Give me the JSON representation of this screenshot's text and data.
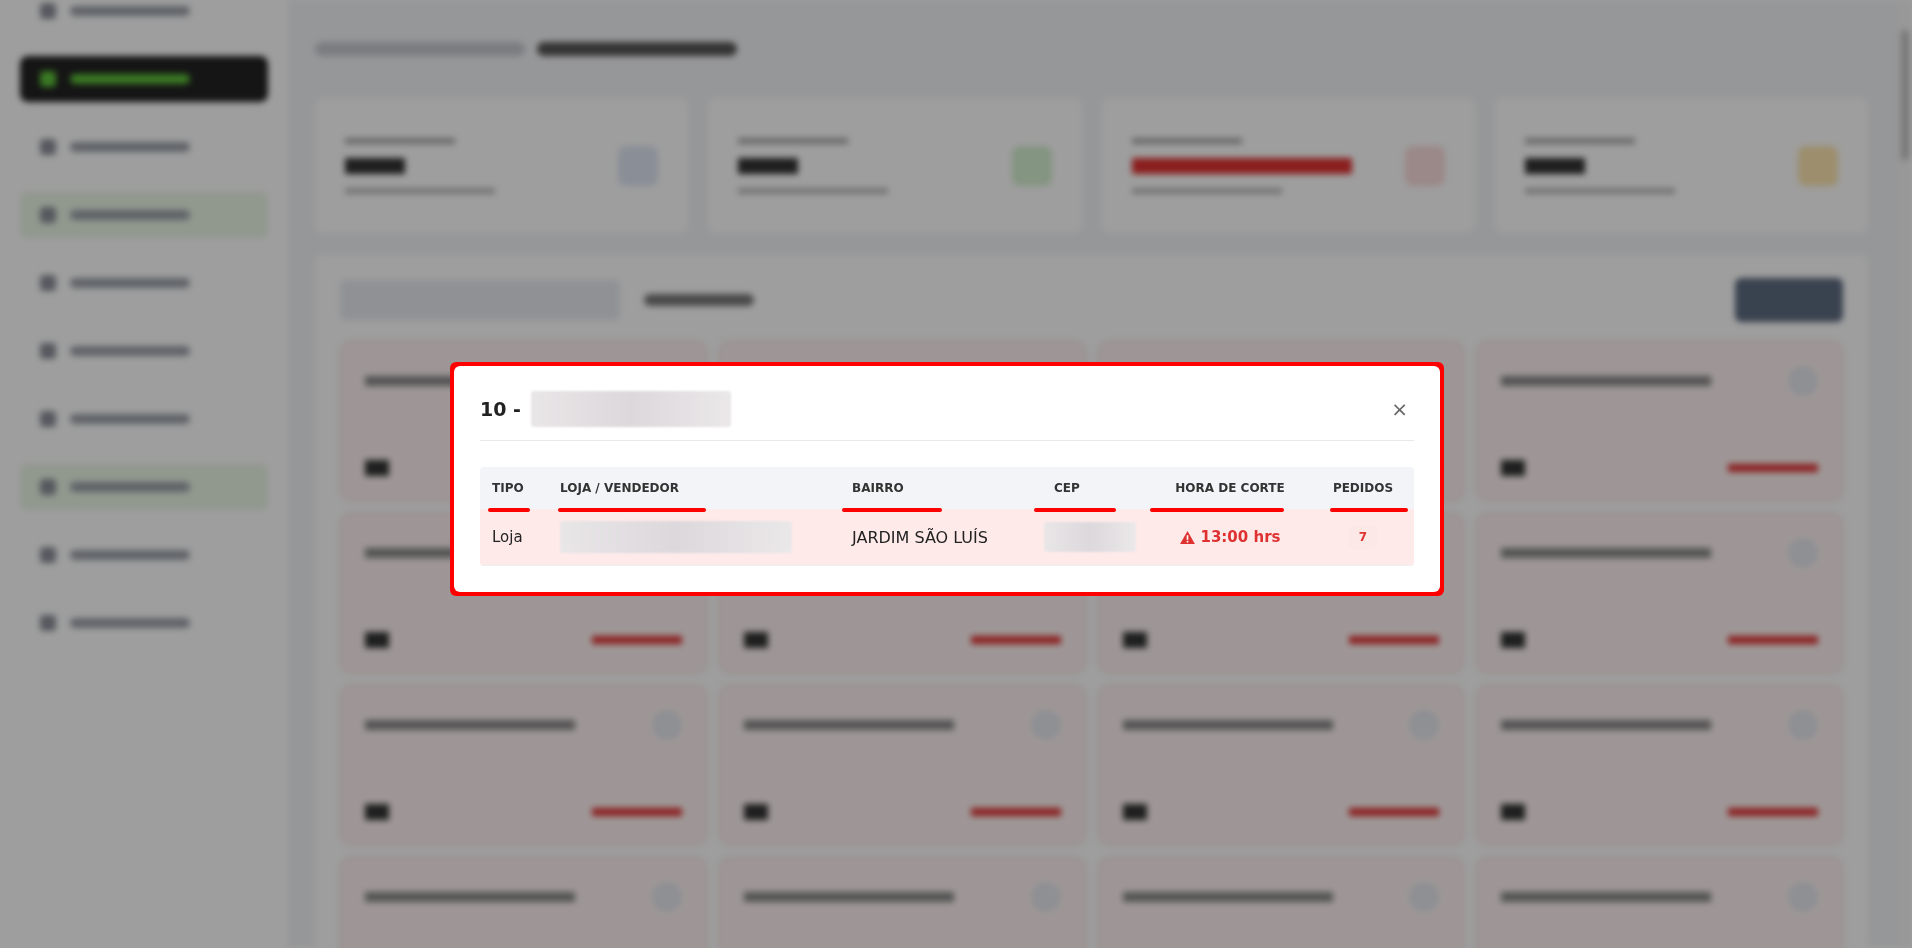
{
  "modal": {
    "title_prefix": "10 -",
    "title_redacted": true,
    "close": "×",
    "table": {
      "columns": [
        {
          "label": "TIPO",
          "underlined": true
        },
        {
          "label": "LOJA / VENDEDOR",
          "underlined": true
        },
        {
          "label": "BAIRRO",
          "underlined": true
        },
        {
          "label": "CEP",
          "underlined": true
        },
        {
          "label": "HORA DE CORTE",
          "underlined": true
        },
        {
          "label": "PEDIDOS",
          "underlined": true
        }
      ],
      "rows": [
        {
          "highlighted": true,
          "cells": [
            {
              "kind": "text",
              "text": "Loja"
            },
            {
              "kind": "redacted"
            },
            {
              "kind": "text",
              "text": "JARDIM SÃO LUÍS"
            },
            {
              "kind": "redacted"
            },
            {
              "kind": "deadline",
              "text": "13:00 hrs",
              "warning": true
            },
            {
              "kind": "count",
              "text": "7"
            }
          ]
        }
      ]
    }
  },
  "annotation": {
    "frame": true
  }
}
